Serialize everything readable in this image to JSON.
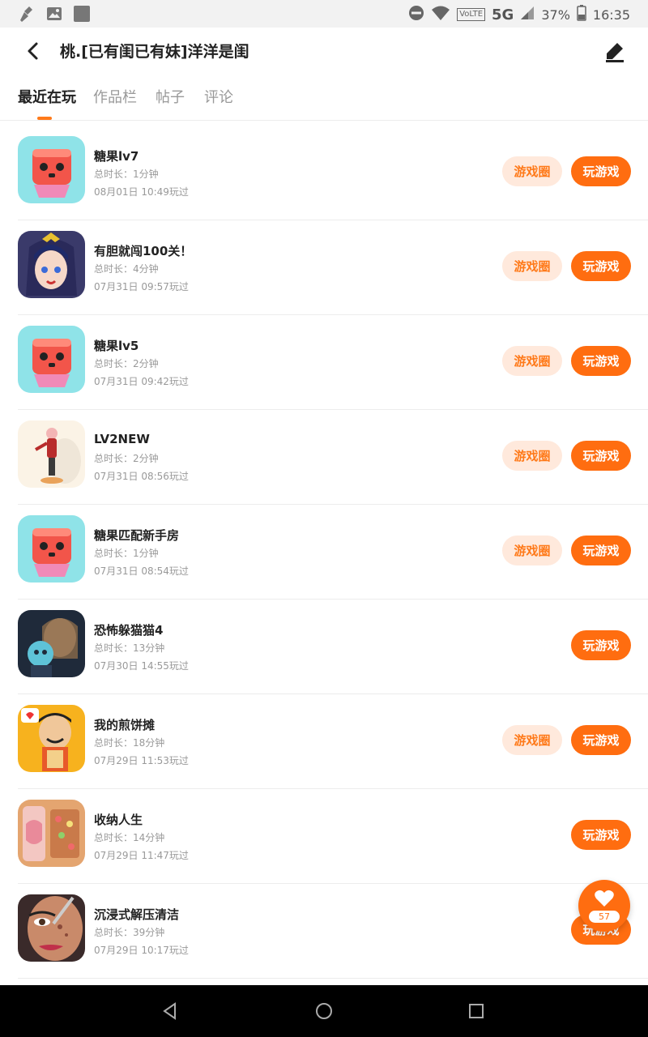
{
  "status_bar": {
    "battery": "37%",
    "time": "16:35",
    "network": "5G",
    "volte": "VoLTE",
    "icons": [
      "broom-icon",
      "image-icon",
      "app-square-icon",
      "dnd-icon",
      "wifi-icon",
      "signal-icon",
      "battery-icon"
    ]
  },
  "header": {
    "title": "桃.[已有闺已有妹]洋洋是闺"
  },
  "tabs": [
    {
      "label": "最近在玩",
      "active": true
    },
    {
      "label": "作品栏",
      "active": false
    },
    {
      "label": "帖子",
      "active": false
    },
    {
      "label": "评论",
      "active": false
    }
  ],
  "items": [
    {
      "name": "糖果lv7",
      "duration": "总时长：1分钟",
      "date": "08月01日 10:49玩过",
      "has_circle": true
    },
    {
      "name": "有胆就闯100关！",
      "duration": "总时长：4分钟",
      "date": "07月31日 09:57玩过",
      "has_circle": true
    },
    {
      "name": "糖果lv5",
      "duration": "总时长：2分钟",
      "date": "07月31日 09:42玩过",
      "has_circle": true
    },
    {
      "name": "LV2NEW",
      "duration": "总时长：2分钟",
      "date": "07月31日 08:56玩过",
      "has_circle": true
    },
    {
      "name": "糖果匹配新手房",
      "duration": "总时长：1分钟",
      "date": "07月31日 08:54玩过",
      "has_circle": true
    },
    {
      "name": "恐怖躲猫猫4",
      "duration": "总时长：13分钟",
      "date": "07月30日 14:55玩过",
      "has_circle": false
    },
    {
      "name": "我的煎饼摊",
      "duration": "总时长：18分钟",
      "date": "07月29日 11:53玩过",
      "has_circle": true
    },
    {
      "name": "收纳人生",
      "duration": "总时长：14分钟",
      "date": "07月29日 11:47玩过",
      "has_circle": false
    },
    {
      "name": "沉浸式解压清洁",
      "duration": "总时长：39分钟",
      "date": "07月29日 10:17玩过",
      "has_circle": false
    }
  ],
  "buttons": {
    "circle_label": "游戏圈",
    "play_label": "玩游戏"
  },
  "fab": {
    "count": "57"
  },
  "colors": {
    "accent": "#ff6d10",
    "accent_light": "#ffe9dc",
    "text_primary": "#222222",
    "text_secondary": "#999999"
  }
}
